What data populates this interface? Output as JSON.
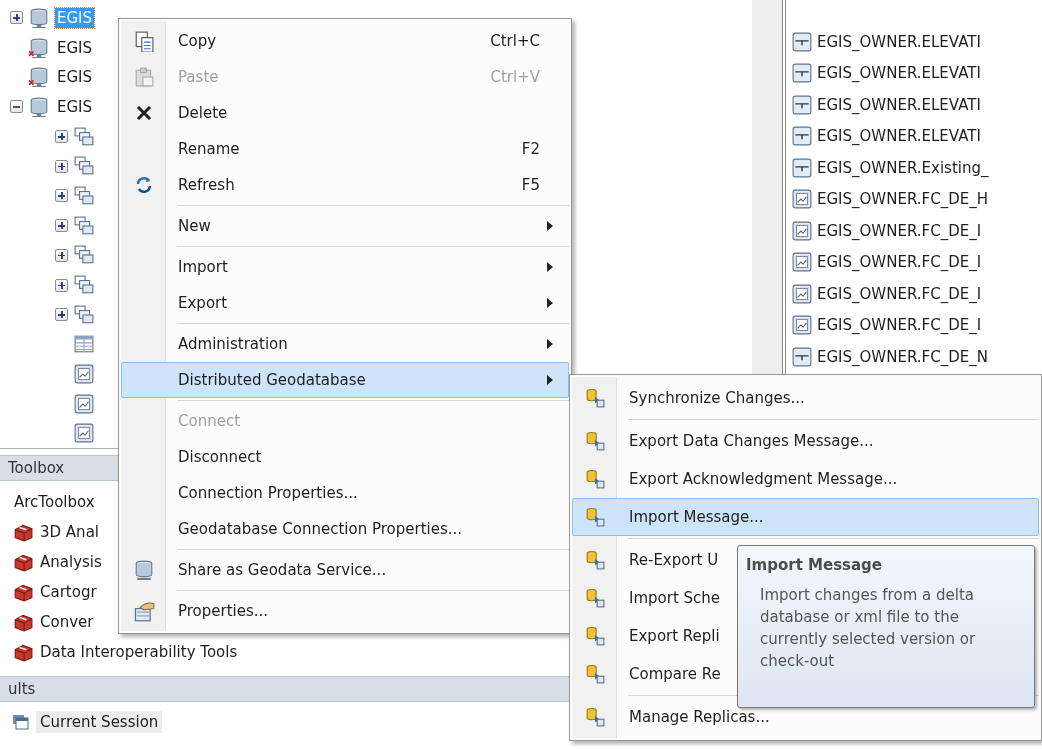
{
  "tree": [
    {
      "label": "EGIS",
      "kind": "database",
      "selected": true,
      "expanded": false,
      "broken": false
    },
    {
      "label": "EGIS",
      "kind": "database",
      "selected": false,
      "broken": true
    },
    {
      "label": "EGIS",
      "kind": "database",
      "selected": false,
      "broken": true
    },
    {
      "label": "EGIS",
      "kind": "database",
      "selected": false,
      "expanded": true,
      "broken": false,
      "children": [
        {
          "kind": "dataset",
          "expanded": false
        },
        {
          "kind": "dataset",
          "expanded": false
        },
        {
          "kind": "dataset",
          "expanded": false
        },
        {
          "kind": "dataset",
          "expanded": false
        },
        {
          "kind": "dataset",
          "expanded": false
        },
        {
          "kind": "dataset",
          "expanded": false
        },
        {
          "kind": "dataset",
          "expanded": false
        },
        {
          "kind": "table"
        },
        {
          "kind": "feature_class"
        },
        {
          "kind": "feature_class"
        },
        {
          "kind": "feature_class"
        }
      ]
    }
  ],
  "catalog_list": [
    {
      "label": "EGIS_OWNER.ELEVATI",
      "kind": "line"
    },
    {
      "label": "EGIS_OWNER.ELEVATI",
      "kind": "line"
    },
    {
      "label": "EGIS_OWNER.ELEVATI",
      "kind": "line"
    },
    {
      "label": "EGIS_OWNER.ELEVATI",
      "kind": "line"
    },
    {
      "label": "EGIS_OWNER.Existing_",
      "kind": "line"
    },
    {
      "label": "EGIS_OWNER.FC_DE_H",
      "kind": "feature_class"
    },
    {
      "label": "EGIS_OWNER.FC_DE_I",
      "kind": "feature_class"
    },
    {
      "label": "EGIS_OWNER.FC_DE_I",
      "kind": "feature_class"
    },
    {
      "label": "EGIS_OWNER.FC_DE_I",
      "kind": "feature_class"
    },
    {
      "label": "EGIS_OWNER.FC_DE_I",
      "kind": "feature_class"
    },
    {
      "label": "EGIS_OWNER.FC_DE_N",
      "kind": "line"
    }
  ],
  "toolbox_panel": {
    "title": "Toolbox",
    "items": [
      {
        "label": "ArcToolbox",
        "kind": "root"
      },
      {
        "label": "3D Anal",
        "kind": "toolbox"
      },
      {
        "label": "Analysis",
        "kind": "toolbox"
      },
      {
        "label": "Cartogr",
        "kind": "toolbox"
      },
      {
        "label": "Conver",
        "kind": "toolbox"
      },
      {
        "label": "Data Interoperability Tools",
        "kind": "toolbox"
      }
    ]
  },
  "results_panel": {
    "title": "ults",
    "items": [
      {
        "label": "Current Session",
        "selected": true
      }
    ]
  },
  "context_menu": {
    "items": [
      {
        "kind": "command",
        "label": "Copy",
        "shortcut": "Ctrl+C",
        "disabled": false,
        "selected": false,
        "submenu": false
      },
      {
        "kind": "command",
        "label": "Paste",
        "shortcut": "Ctrl+V",
        "disabled": true,
        "selected": false,
        "submenu": false
      },
      {
        "kind": "command",
        "label": "Delete",
        "disabled": false,
        "selected": false,
        "submenu": false
      },
      {
        "kind": "command",
        "label": "Rename",
        "shortcut": "F2",
        "disabled": false,
        "selected": false,
        "submenu": false
      },
      {
        "kind": "command",
        "label": "Refresh",
        "shortcut": "F5",
        "disabled": false,
        "selected": false,
        "submenu": false
      },
      {
        "kind": "separator"
      },
      {
        "kind": "command",
        "label": "New",
        "disabled": false,
        "selected": false,
        "submenu": true
      },
      {
        "kind": "separator"
      },
      {
        "kind": "command",
        "label": "Import",
        "disabled": false,
        "selected": false,
        "submenu": true
      },
      {
        "kind": "command",
        "label": "Export",
        "disabled": false,
        "selected": false,
        "submenu": true
      },
      {
        "kind": "separator"
      },
      {
        "kind": "command",
        "label": "Administration",
        "disabled": false,
        "selected": false,
        "submenu": true
      },
      {
        "kind": "command",
        "label": "Distributed Geodatabase",
        "disabled": false,
        "selected": true,
        "submenu": true
      },
      {
        "kind": "separator"
      },
      {
        "kind": "command",
        "label": "Connect",
        "disabled": true,
        "selected": false,
        "submenu": false
      },
      {
        "kind": "command",
        "label": "Disconnect",
        "disabled": false,
        "selected": false,
        "submenu": false
      },
      {
        "kind": "command",
        "label": "Connection Properties...",
        "disabled": false,
        "selected": false,
        "submenu": false
      },
      {
        "kind": "command",
        "label": "Geodatabase Connection Properties...",
        "disabled": false,
        "selected": false,
        "submenu": false
      },
      {
        "kind": "separator"
      },
      {
        "kind": "command",
        "label": "Share as Geodata Service...",
        "disabled": false,
        "selected": false,
        "submenu": false
      },
      {
        "kind": "separator"
      },
      {
        "kind": "command",
        "label": "Properties...",
        "disabled": false,
        "selected": false,
        "submenu": false
      }
    ]
  },
  "submenu": {
    "items": [
      {
        "kind": "command",
        "label": "Synchronize Changes...",
        "selected": false
      },
      {
        "kind": "separator"
      },
      {
        "kind": "command",
        "label": "Export Data Changes Message...",
        "selected": false
      },
      {
        "kind": "command",
        "label": "Export Acknowledgment Message...",
        "selected": false
      },
      {
        "kind": "command",
        "label": "Import Message...",
        "selected": true
      },
      {
        "kind": "separator"
      },
      {
        "kind": "command",
        "label": "Re-Export U",
        "selected": false
      },
      {
        "kind": "command",
        "label": "Import Sche",
        "selected": false
      },
      {
        "kind": "command",
        "label": "Export Repli",
        "selected": false
      },
      {
        "kind": "command",
        "label": "Compare Re",
        "selected": false
      },
      {
        "kind": "separator"
      },
      {
        "kind": "command",
        "label": "Manage Replicas...",
        "selected": false
      }
    ]
  },
  "tooltip": {
    "title": "Import Message",
    "text": "Import changes from a delta database or xml file to the currently selected version or check-out"
  }
}
